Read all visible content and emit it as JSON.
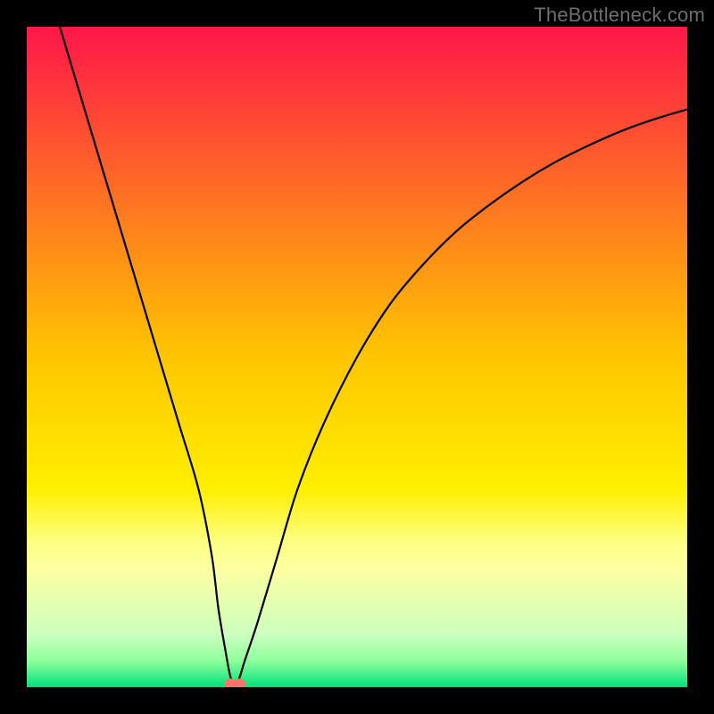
{
  "watermark": "TheBottleneck.com",
  "chart_data": {
    "type": "line",
    "title": "",
    "xlabel": "",
    "ylabel": "",
    "xlim": [
      0,
      100
    ],
    "ylim": [
      0,
      100
    ],
    "grid": false,
    "legend": false,
    "gradient_stops": [
      {
        "pos": 0.0,
        "color": "#ff1649"
      },
      {
        "pos": 0.5,
        "color": "#ffc600"
      },
      {
        "pos": 0.7,
        "color": "#ffef00"
      },
      {
        "pos": 0.78,
        "color": "#fdff82"
      },
      {
        "pos": 0.82,
        "color": "#fdffa0"
      },
      {
        "pos": 0.92,
        "color": "#ccffbf"
      },
      {
        "pos": 0.96,
        "color": "#8fff9c"
      },
      {
        "pos": 1.0,
        "color": "#00e07a"
      }
    ],
    "series": [
      {
        "name": "bottleneck-curve",
        "color": "#000000",
        "x": [
          5,
          8,
          11,
          14,
          17,
          20,
          23,
          26,
          28,
          29,
          30,
          31,
          32,
          33,
          35,
          38,
          41,
          45,
          50,
          55,
          60,
          65,
          70,
          75,
          80,
          85,
          90,
          95,
          100
        ],
        "y": [
          100,
          90,
          80,
          70,
          60,
          50,
          40,
          30,
          20,
          12,
          6,
          1,
          1,
          4,
          10,
          20,
          30,
          40,
          50,
          58,
          64,
          69,
          73,
          76.5,
          79.5,
          82,
          84.2,
          86,
          87.5
        ]
      }
    ],
    "marker": {
      "name": "optimal-point",
      "x": 31.5,
      "y": 0.5,
      "color": "#fd7469",
      "shape": "double-dot"
    }
  }
}
